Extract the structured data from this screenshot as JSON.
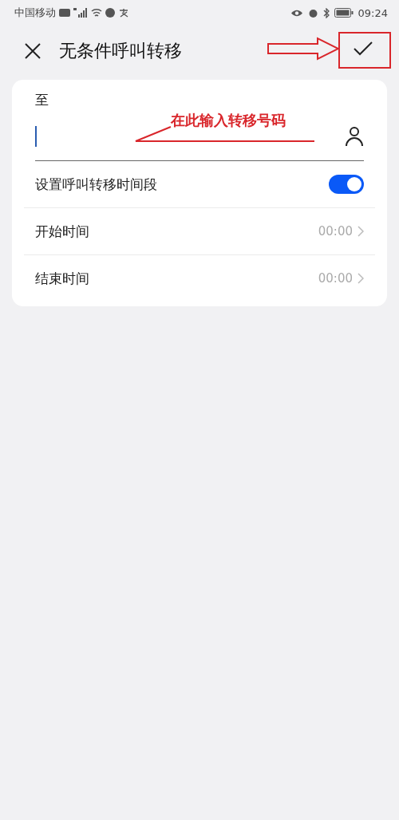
{
  "status_bar": {
    "carrier": "中国移动",
    "time": "09:24"
  },
  "header": {
    "title": "无条件呼叫转移"
  },
  "form": {
    "label": "至",
    "placeholder_annotation": "在此输入转移号码",
    "rows": [
      {
        "kind": "toggle",
        "label": "设置呼叫转移时间段",
        "on": true
      },
      {
        "kind": "time",
        "label": "开始时间",
        "value": "00:00"
      },
      {
        "kind": "time",
        "label": "结束时间",
        "value": "00:00"
      }
    ]
  }
}
